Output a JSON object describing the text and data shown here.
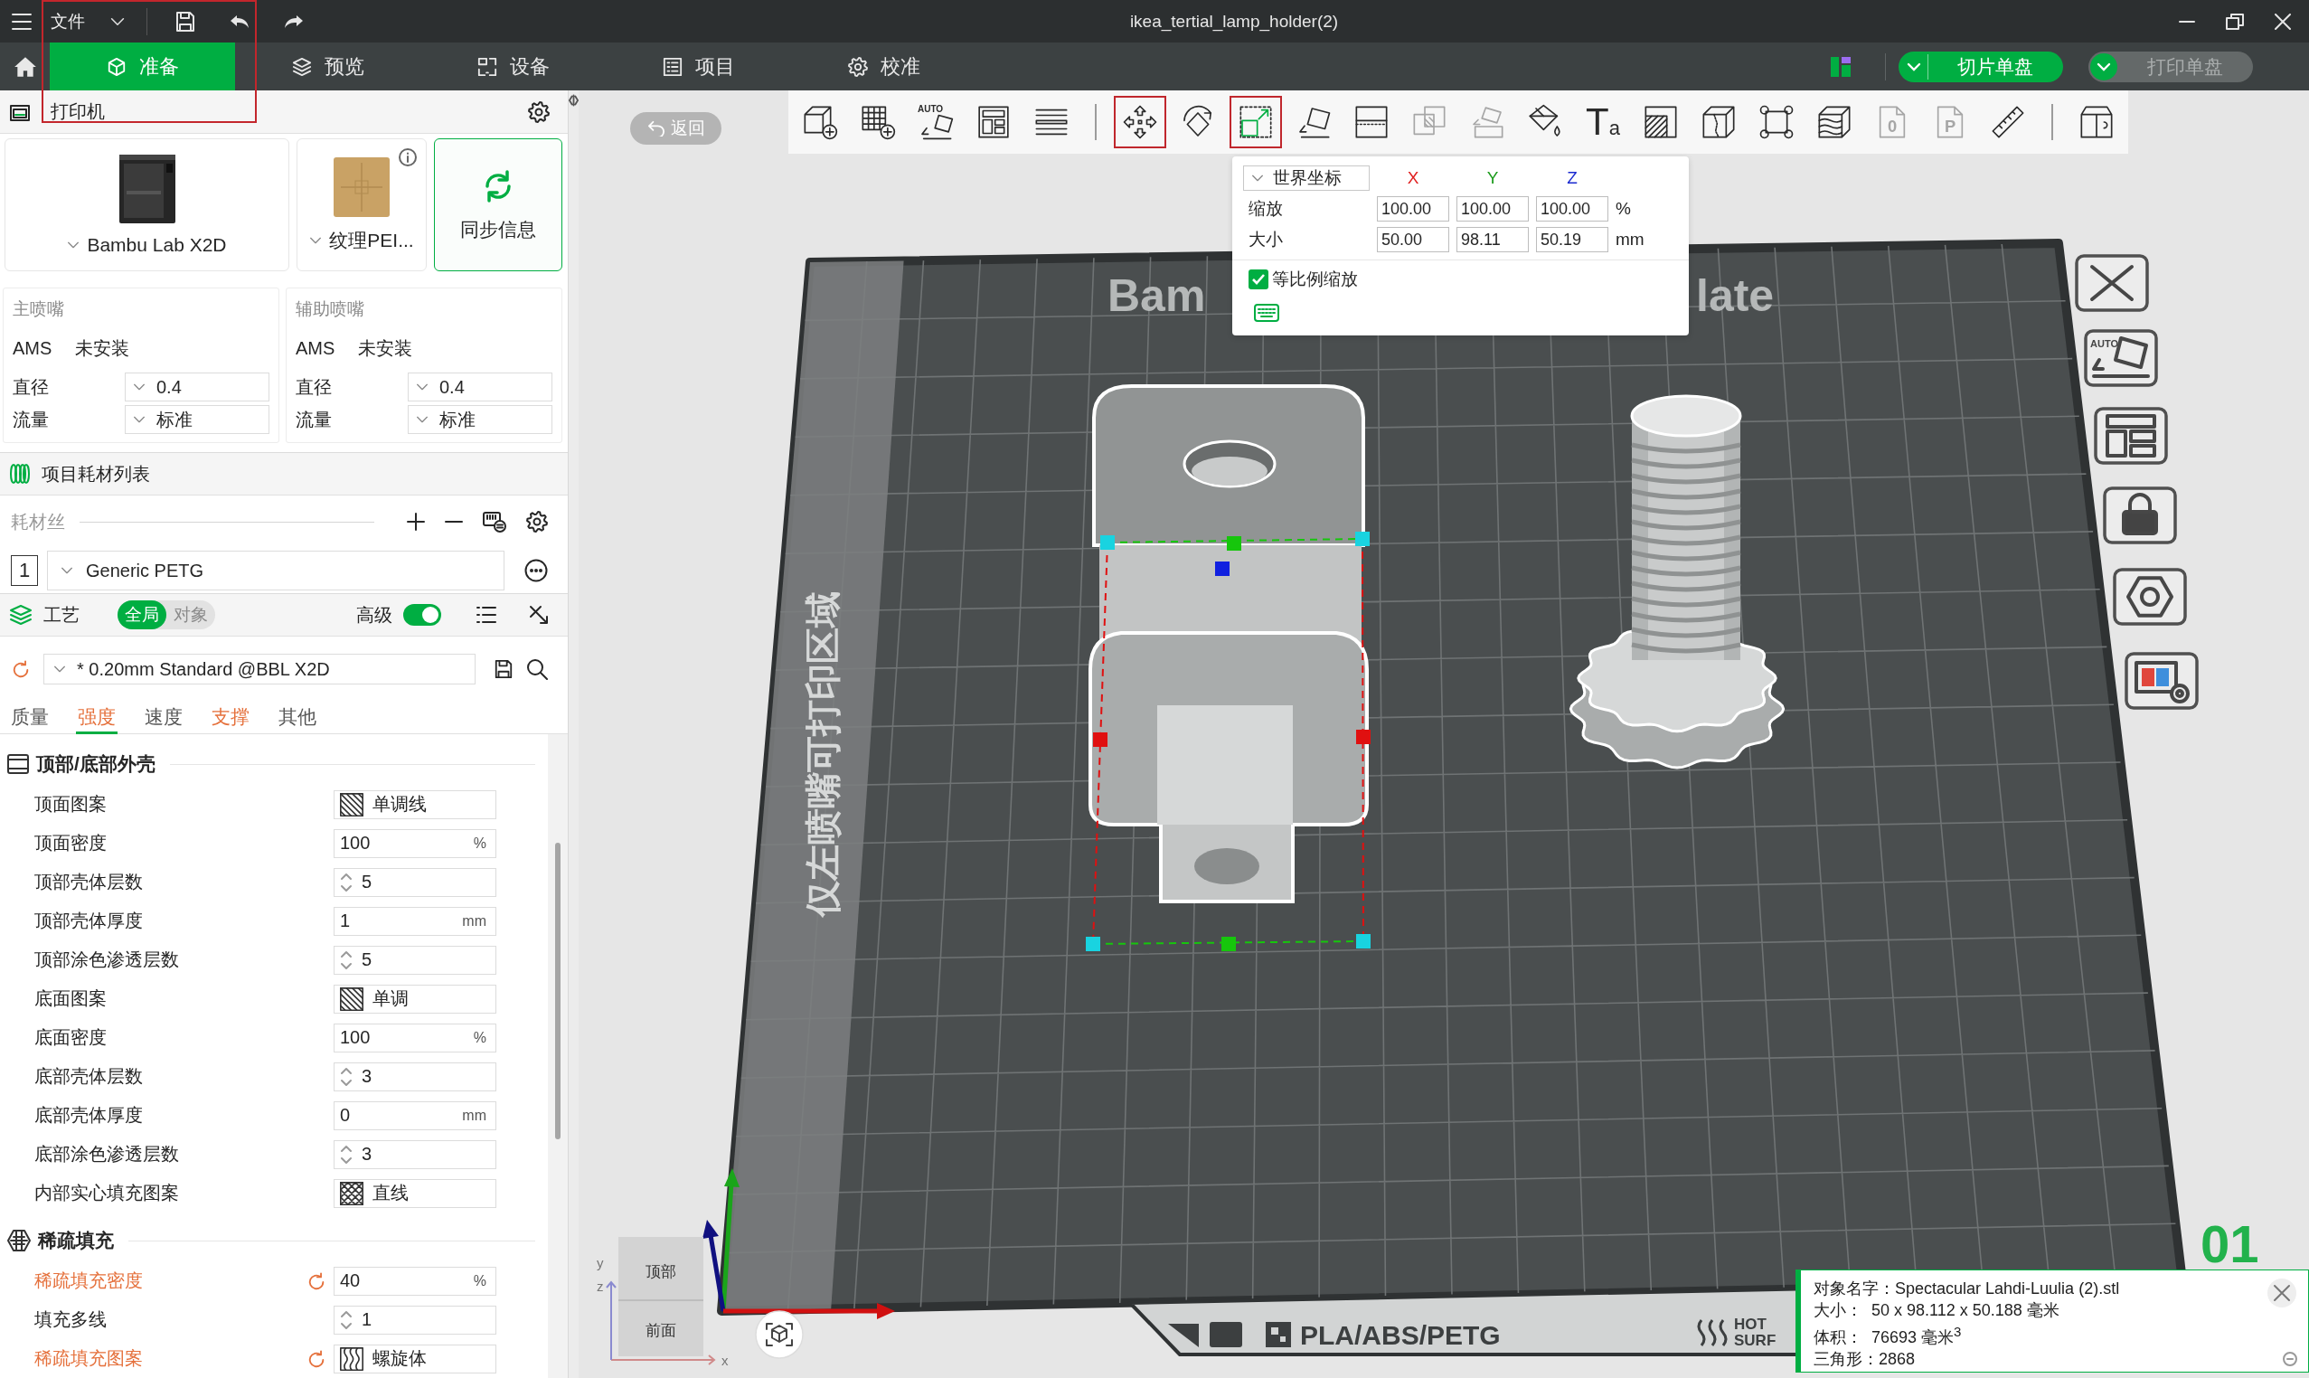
{
  "title_bar": {
    "menu": "文件",
    "title": "ikea_tertial_lamp_holder(2)"
  },
  "tabs": [
    {
      "label": "准备",
      "selected": true
    },
    {
      "label": "预览",
      "selected": false
    },
    {
      "label": "设备",
      "selected": false
    },
    {
      "label": "项目",
      "selected": false
    },
    {
      "label": "校准",
      "selected": false
    }
  ],
  "actions": [
    {
      "label": "切片单盘",
      "enabled": true
    },
    {
      "label": "打印单盘",
      "enabled": false
    }
  ],
  "printer": {
    "title": "打印机",
    "model": "Bambu Lab X2D",
    "plate": "纹理PEI...",
    "sync": "同步信息"
  },
  "nozzles": [
    {
      "title": "主喷嘴",
      "ams_label": "AMS",
      "ams_value": "未安装",
      "diameter_label": "直径",
      "diameter": "0.4",
      "flow_label": "流量",
      "flow": "标准"
    },
    {
      "title": "辅助喷嘴",
      "ams_label": "AMS",
      "ams_value": "未安装",
      "diameter_label": "直径",
      "diameter": "0.4",
      "flow_label": "流量",
      "flow": "标准"
    }
  ],
  "filaments": {
    "title": "项目耗材列表",
    "label": "耗材丝",
    "items": [
      {
        "number": "1",
        "name": "Generic PETG",
        "color": "#ffffff"
      }
    ]
  },
  "process": {
    "title": "工艺",
    "scopes": [
      {
        "label": "全局",
        "selected": true
      },
      {
        "label": "对象",
        "selected": false
      }
    ],
    "advanced_label": "高级",
    "advanced": true,
    "preset": "* 0.20mm Standard @BBL X2D",
    "preset_modified": true,
    "tabs": [
      {
        "label": "质量",
        "selected": false,
        "modified": false
      },
      {
        "label": "强度",
        "selected": true,
        "modified": true
      },
      {
        "label": "速度",
        "selected": false,
        "modified": false
      },
      {
        "label": "支撑",
        "selected": false,
        "modified": true
      },
      {
        "label": "其他",
        "selected": false,
        "modified": false
      }
    ],
    "sections": [
      {
        "title": "顶部/底部外壳",
        "rows": [
          {
            "label": "顶面图案",
            "kind": "pattern",
            "value": "单调线",
            "modified": false
          },
          {
            "label": "顶面密度",
            "kind": "number",
            "value": "100",
            "unit": "%",
            "modified": false
          },
          {
            "label": "顶部壳体层数",
            "kind": "spin",
            "value": "5",
            "modified": false
          },
          {
            "label": "顶部壳体厚度",
            "kind": "number",
            "value": "1",
            "unit": "mm",
            "modified": false
          },
          {
            "label": "顶部涂色渗透层数",
            "kind": "spin",
            "value": "5",
            "modified": false
          },
          {
            "label": "底面图案",
            "kind": "pattern",
            "value": "单调",
            "modified": false
          },
          {
            "label": "底面密度",
            "kind": "number",
            "value": "100",
            "unit": "%",
            "modified": false
          },
          {
            "label": "底部壳体层数",
            "kind": "spin",
            "value": "3",
            "modified": false
          },
          {
            "label": "底部壳体厚度",
            "kind": "number",
            "value": "0",
            "unit": "mm",
            "modified": false
          },
          {
            "label": "底部涂色渗透层数",
            "kind": "spin",
            "value": "3",
            "modified": false
          },
          {
            "label": "内部实心填充图案",
            "kind": "pattern",
            "value": "直线",
            "modified": false
          }
        ]
      },
      {
        "title": "稀疏填充",
        "rows": [
          {
            "label": "稀疏填充密度",
            "kind": "number",
            "value": "40",
            "unit": "%",
            "modified": true
          },
          {
            "label": "填充多线",
            "kind": "spin",
            "value": "1",
            "modified": false
          },
          {
            "label": "稀疏填充图案",
            "kind": "pattern",
            "value": "螺旋体",
            "modified": true
          }
        ]
      }
    ]
  },
  "viewport": {
    "back": "返回",
    "toolbar": [
      {
        "highlighted": false,
        "disabled": false
      },
      {
        "highlighted": false,
        "disabled": false
      },
      {
        "highlighted": false,
        "disabled": false,
        "badge": "AUTO"
      },
      {
        "highlighted": false,
        "disabled": false
      },
      {
        "highlighted": false,
        "disabled": false
      },
      {
        "highlighted": true,
        "disabled": false
      },
      {
        "highlighted": false,
        "disabled": false
      },
      {
        "highlighted": true,
        "disabled": false
      },
      {
        "highlighted": false,
        "disabled": false
      },
      {
        "highlighted": false,
        "disabled": false
      },
      {
        "highlighted": false,
        "disabled": true
      },
      {
        "highlighted": false,
        "disabled": true
      },
      {
        "highlighted": false,
        "disabled": false
      },
      {
        "highlighted": false,
        "disabled": false,
        "badge": "T$_{a}$"
      },
      {
        "highlighted": false,
        "disabled": false
      },
      {
        "highlighted": false,
        "disabled": false
      },
      {
        "highlighted": false,
        "disabled": false
      },
      {
        "highlighted": false,
        "disabled": false
      },
      {
        "highlighted": false,
        "disabled": true,
        "badge": "0"
      },
      {
        "highlighted": false,
        "disabled": true,
        "badge": "P"
      },
      {
        "highlighted": false,
        "disabled": false
      },
      {
        "highlighted": false,
        "disabled": false
      }
    ],
    "scale_panel": {
      "coordinate": "世界坐标",
      "axes": [
        {
          "label": "X",
          "color": "#e02020"
        },
        {
          "label": "Y",
          "color": "#1a9a1a"
        },
        {
          "label": "Z",
          "color": "#1a2ad0"
        }
      ],
      "rows": [
        {
          "label": "缩放",
          "values": [
            "100.00",
            "100.00",
            "100.00"
          ],
          "unit": "%"
        },
        {
          "label": "大小",
          "values": [
            "50.00",
            "98.11",
            "50.19"
          ],
          "unit": "mm"
        }
      ],
      "uniform_label": "等比例缩放",
      "uniform": true
    },
    "plate": {
      "brand": "Bam",
      "name": "late",
      "zone": "仅左喷嘴可打印区域",
      "materials": "PLA/ABS/PETG",
      "surface": [
        "HOT",
        "SURF"
      ],
      "number": "01",
      "auto_label": "AUTO"
    },
    "view_cube": {
      "top": "顶部",
      "front": "前面",
      "axes": [
        "x",
        "y",
        "z"
      ]
    },
    "object_info": [
      "对象名字：Spectacular Lahdi-Luulia (2).stl",
      "大小：  50 x 98.112 x 50.188 毫米",
      "体积：  76693 毫米$^{3}$",
      "三角形：2868"
    ]
  }
}
